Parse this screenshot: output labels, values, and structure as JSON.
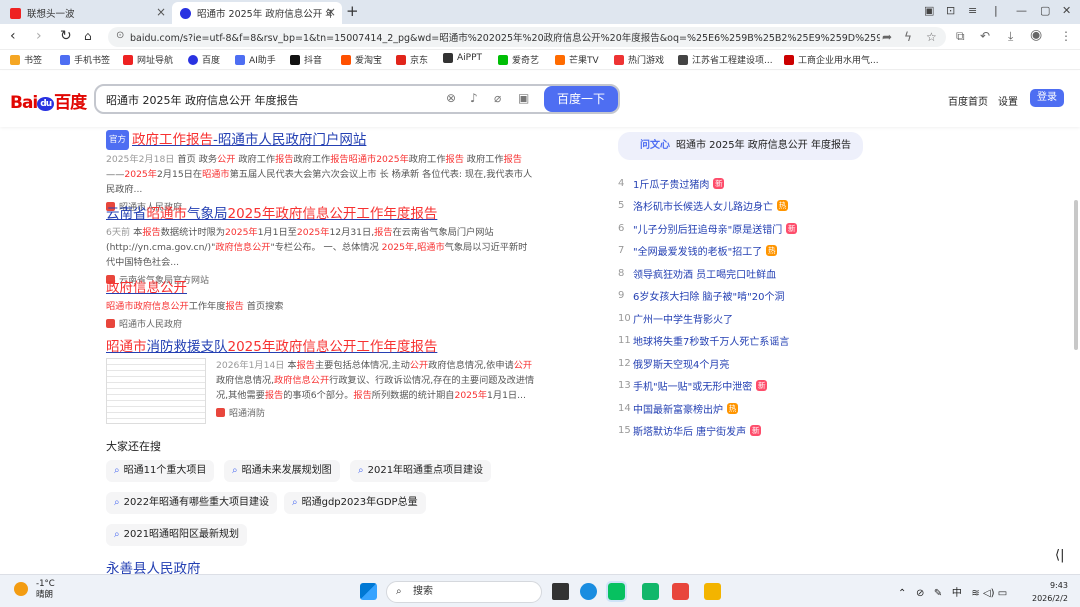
{
  "browser": {
    "tabs": [
      {
        "title": "联想头一波",
        "icon_color": "#e22"
      },
      {
        "title": "昭通市 2025年 政府信息公开 年度",
        "icon_color": "#2932e1"
      }
    ],
    "url": "baidu.com/s?ie=utf-8&f=8&rsv_bp=1&tn=15007414_2_pg&wd=昭通市%202025年%20政府信息公开%20年度报告&oq=%25E6%259B%25B2%25E9%259D%2596%25E5%25B8%2582%25..."
  },
  "bookmarks": [
    {
      "label": "书签",
      "color": "#f5a623"
    },
    {
      "label": "手机书签",
      "color": "#4e6ef2"
    },
    {
      "label": "网址导航",
      "color": "#e22"
    },
    {
      "label": "百度",
      "color": "#2932e1"
    },
    {
      "label": "AI助手",
      "color": "#4e6ef2"
    },
    {
      "label": "抖音",
      "color": "#111"
    },
    {
      "label": "爱淘宝",
      "color": "#ff5000"
    },
    {
      "label": "京东",
      "color": "#e1251b"
    },
    {
      "label": "AiPPT",
      "color": "#333"
    },
    {
      "label": "爱奇艺",
      "color": "#00be06"
    },
    {
      "label": "芒果TV",
      "color": "#ff6b00"
    },
    {
      "label": "热门游戏",
      "color": "#e33"
    },
    {
      "label": "江苏省工程建设项...",
      "color": "#444"
    },
    {
      "label": "工商企业用水用气...",
      "color": "#c00"
    }
  ],
  "search": {
    "query": "昭通市 2025年 政府信息公开 年度报告",
    "button": "百度一下",
    "header_links": [
      "百度首页",
      "设置"
    ],
    "login": "登录"
  },
  "results": [
    {
      "badge": "官方",
      "title_parts": [
        [
          "政府工作报告",
          true
        ],
        [
          "-昭通市人民政府门户网站",
          false
        ]
      ],
      "date": "2025年2月18日",
      "snippet": "首页 政务公开 政府工作报告政府工作报告昭通市2025年政府工作报告 政府工作报告——2025年2月15日在昭通市第五届人民代表大会第六次会议上市 长 杨承新 各位代表: 现在,我代表市人民政府...",
      "source": "昭通市人民政府"
    },
    {
      "title_parts": [
        [
          "云南省",
          false
        ],
        [
          "昭通市",
          true
        ],
        [
          "气象局",
          false
        ],
        [
          "2025年政府信息公开工作年度报告",
          true
        ]
      ],
      "date": "6天前",
      "snippet": "本报告数据统计时限为2025年1月1日至2025年12月31日,报告在云南省气象局门户网站(http://yn.cma.gov.cn/)\"政府信息公开\"专栏公布。 一、总体情况 2025年,昭通市气象局以习近平新时代中国特色社会...",
      "source": "云南省气象局官方网站"
    },
    {
      "title_parts": [
        [
          "政府信息公开",
          true
        ]
      ],
      "snippet": "昭通市政府信息公开工作年度报告 首页搜索",
      "source": "昭通市人民政府"
    },
    {
      "title_parts": [
        [
          "昭通市",
          true
        ],
        [
          "消防救援支队",
          false
        ],
        [
          "2025年政府信息公开工作年度报告",
          true
        ]
      ],
      "date": "2026年1月14日",
      "snippet": "本报告主要包括总体情况,主动公开政府信息情况,依申请公开政府信息情况,政府信息公开行政复议、行政诉讼情况,存在的主要问题及改进情况,其他需要报告的事项6个部分。报告所列数据的统计期自2025年1月1日...",
      "source": "昭通消防"
    }
  ],
  "related": {
    "heading": "大家还在搜",
    "items": [
      "昭通11个重大项目",
      "昭通未来发展规划图",
      "2021年昭通重点项目建设",
      "2022年昭通有哪些重大项目建设",
      "昭通gdp2023年GDP总量",
      "2021昭通昭阳区最新规划"
    ]
  },
  "next_result_title": "永善县人民政府",
  "sidebar": {
    "ai_label": "问文心",
    "ai_query": "昭通市 2025年 政府信息公开 年度报告",
    "hot": [
      {
        "rank": "4",
        "text": "1斤瓜子贵过猪肉",
        "tag": "新"
      },
      {
        "rank": "5",
        "text": "洛杉矶市长候选人女儿路边身亡",
        "tag": "热"
      },
      {
        "rank": "6",
        "text": "\"儿子分别后狂追母亲\"原是送错门",
        "tag": "新"
      },
      {
        "rank": "7",
        "text": "\"全网最爱发钱的老板\"招工了",
        "tag": "热"
      },
      {
        "rank": "8",
        "text": "领导疯狂劝酒 员工喝完口吐鲜血",
        "tag": ""
      },
      {
        "rank": "9",
        "text": "6岁女孩大扫除 脑子被\"啃\"20个洞",
        "tag": ""
      },
      {
        "rank": "10",
        "text": "广州一中学生背影火了",
        "tag": ""
      },
      {
        "rank": "11",
        "text": "地球将失重7秒致千万人死亡系谣言",
        "tag": ""
      },
      {
        "rank": "12",
        "text": "俄罗斯天空现4个月亮",
        "tag": ""
      },
      {
        "rank": "13",
        "text": "手机\"贴一贴\"或无形中泄密",
        "tag": "新"
      },
      {
        "rank": "14",
        "text": "中国最新富豪榜出炉",
        "tag": "热"
      },
      {
        "rank": "15",
        "text": "斯塔默访华后 唐宁街发声",
        "tag": "新"
      }
    ]
  },
  "taskbar": {
    "temp": "-1°C",
    "weather": "晴朗",
    "search": "搜索",
    "tray_lang": "中",
    "time": "9:43",
    "date": "2026/2/2"
  }
}
